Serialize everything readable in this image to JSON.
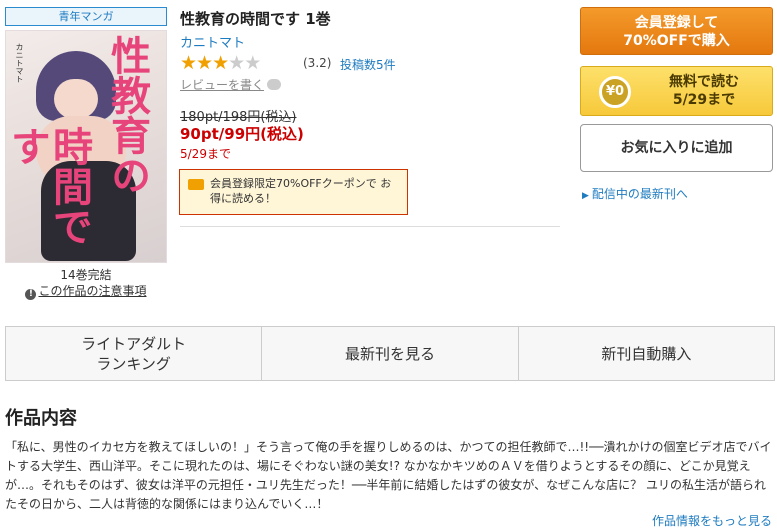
{
  "badge": {
    "genre": "青年マンガ"
  },
  "book": {
    "title": "性教育の時間です 1巻",
    "author": "カニトマト",
    "rating_value": "(3.2)",
    "rating_stars": 3,
    "rating_max": 5,
    "review_count": "投稿数5件",
    "write_review": "レビューを書く",
    "volume_count": "14巻完結",
    "caution_link": "この作品の注意事項"
  },
  "cover": {
    "title_part1": "性教育の",
    "title_part2": "時間です",
    "author": "カニトマト"
  },
  "pricing": {
    "original": "180pt/198円(税込)",
    "sale": "90pt/99円(税込)",
    "until": "5/29まで",
    "coupon_text": "会員登録限定70%OFFクーポンで お得に読める！"
  },
  "actions": {
    "register_line1": "会員登録して",
    "register_line2": "70%OFFで購入",
    "free_coin": "¥0",
    "free_line1": "無料で読む",
    "free_line2": "5/29まで",
    "favorite": "お気に入りに追加",
    "latest": "配信中の最新刊へ"
  },
  "nav": {
    "ranking_line1": "ライトアダルト",
    "ranking_line2": "ランキング",
    "latest": "最新刊を見る",
    "auto_buy": "新刊自動購入"
  },
  "summary": {
    "heading": "作品内容",
    "text": "「私に、男性のイカセ方を教えてほしいの！」そう言って俺の手を握りしめるのは、かつての担任教師で…!!──潰れかけの個室ビデオ店でバイトする大学生、西山洋平。そこに現れたのは、場にそぐわない謎の美女!? なかなかキツめのＡＶを借りようとするその顔に、どこか見覚えが…。それもそのはず、彼女は洋平の元担任・ユリ先生だった！──半年前に結婚したはずの彼女が、なぜこんな店に？ ユリの私生活が語られたその日から、二人は背徳的な関係にはまり込んでいく…！",
    "more": "作品情報をもっと見る"
  },
  "colors": {
    "accent_blue": "#1d7bc0",
    "price_red": "#cc0000",
    "register_orange": "#f08a1e",
    "free_yellow": "#f9d54a",
    "star_gold": "#f0a000"
  }
}
